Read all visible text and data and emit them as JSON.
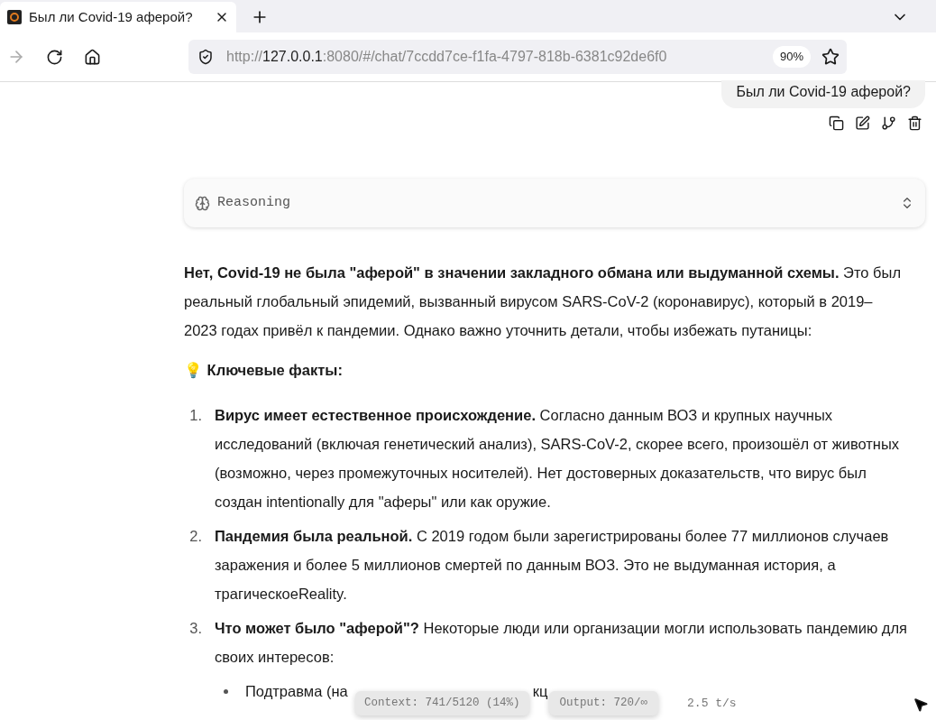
{
  "browser": {
    "tab": {
      "title": "Был ли Covid-19 аферой?",
      "selected": true
    },
    "url": [
      {
        "text": "http://",
        "kind": "dim"
      },
      {
        "text": "127.0.0.1",
        "kind": "host"
      },
      {
        "text": ":8080/#/chat/7ccdd7ce-f1fa-4797-818b-6381c92de6f0",
        "kind": "dim"
      }
    ],
    "zoom": "90%"
  },
  "user_message": "Был ли Covid-19 аферой?",
  "reasoning": {
    "label": "Reasoning",
    "expanded": false
  },
  "answer": {
    "intro": "**Нет, Covid-19 не была \"аферой\" в значении закладного обмана или выдуманной схемы.** Это был реальный глобальный эпидемий, вызванный вирусом SARS-CoV-2 (коронавирус), который в 2019–2023 годах привёл к пандемии. Однако важно уточнить детали, чтобы избежать путаницы:",
    "heading": "💡 Ключевые факты:",
    "items": [
      {
        "number": "1.",
        "text": "**Вирус имеет естественное происхождение.** Согласно данным ВОЗ и крупных научных исследований (включая генетический анализ), SARS-CoV-2, скорее всего, произошёл от животных (возможно, через промежуточных носителей). Нет достоверных доказательств, что вирус был создан intentionally для \"аферы\" или как оружие."
      },
      {
        "number": "2.",
        "text": "**Пандемия была реальной.** С 2019 годом были зарегистрированы более 77 миллионов случаев заражения и более 5 миллионов смертей по данным ВОЗ. Это не выдуманная история, а трагическоеReality."
      },
      {
        "number": "3.",
        "text": "**Что может было \"аферой\"?** Некоторые люди или организации могли использовать пандемию для своих интересов:",
        "bullets": [
          {
            "start": "Подтравма (на",
            "end": "кц"
          }
        ]
      }
    ]
  },
  "stats": {
    "context": "Context: 741/5120 (14%)",
    "output": "Output: 720/∞",
    "speed": "2.5 t/s"
  }
}
